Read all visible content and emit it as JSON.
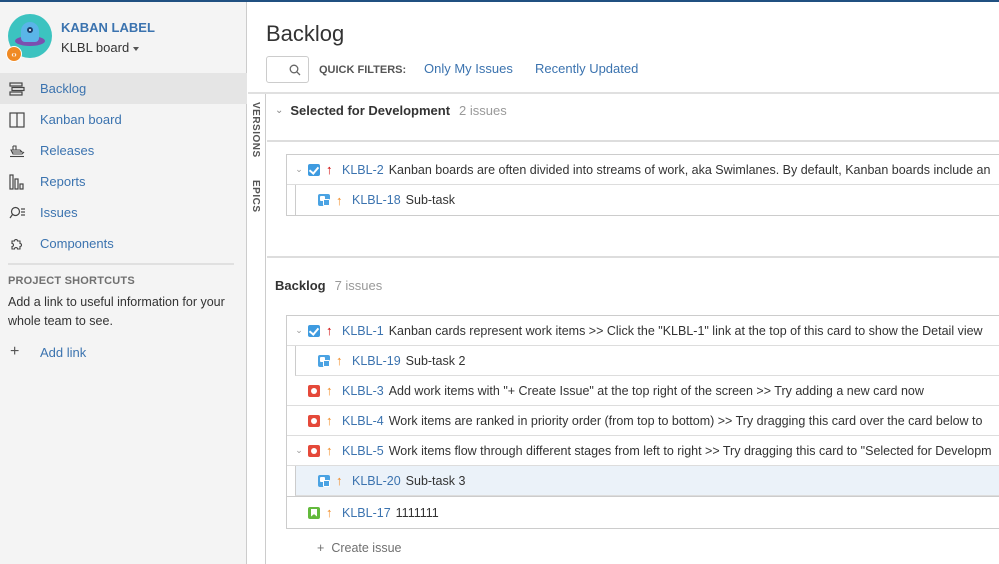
{
  "colors": {
    "link": "#3b73af",
    "header_bar": "#205081",
    "priority_high": "#ce0000",
    "priority_medium": "#f18a24",
    "story": "#3e9be0",
    "bug": "#e5493a",
    "improvement": "#63ba3c",
    "selected_row": "#ebf2f9"
  },
  "sidebar": {
    "project_name": "KABAN LABEL",
    "board_name": "KLBL board",
    "dev_badge": "‹›",
    "nav_items": [
      {
        "label": "Backlog",
        "icon": "backlog-icon",
        "active": true
      },
      {
        "label": "Kanban board",
        "icon": "board-icon",
        "active": false
      },
      {
        "label": "Releases",
        "icon": "ship-icon",
        "active": false
      },
      {
        "label": "Reports",
        "icon": "reports-icon",
        "active": false
      },
      {
        "label": "Issues",
        "icon": "issues-search-icon",
        "active": false
      },
      {
        "label": "Components",
        "icon": "puzzle-icon",
        "active": false
      }
    ],
    "shortcuts": {
      "title": "PROJECT SHORTCUTS",
      "text": "Add a link to useful information for your whole team to see.",
      "add_link": "Add link"
    }
  },
  "main": {
    "title": "Backlog",
    "search": {
      "placeholder": "",
      "value": ""
    },
    "quick_filters_label": "QUICK FILTERS:",
    "quick_filters": [
      "Only My Issues",
      "Recently Updated"
    ],
    "side_tabs": [
      "VERSIONS",
      "EPICS"
    ],
    "sections": [
      {
        "name": "Selected for Development",
        "count": "2 issues",
        "issues": [
          {
            "key": "KLBL-2",
            "type": "story",
            "priority": "high",
            "expandable": true,
            "sub": false,
            "summary": "Kanban boards are often divided into streams of work, aka Swimlanes. By default, Kanban boards include an"
          },
          {
            "key": "KLBL-18",
            "type": "sub-task",
            "priority": "medium",
            "expandable": false,
            "sub": true,
            "summary": "Sub-task"
          }
        ]
      },
      {
        "name": "Backlog",
        "count": "7 issues",
        "issues": [
          {
            "key": "KLBL-1",
            "type": "story",
            "priority": "high",
            "expandable": true,
            "sub": false,
            "summary": "Kanban cards represent work items >> Click the \"KLBL-1\" link at the top of this card to show the Detail view"
          },
          {
            "key": "KLBL-19",
            "type": "sub-task",
            "priority": "medium",
            "expandable": false,
            "sub": true,
            "summary": "Sub-task 2"
          },
          {
            "key": "KLBL-3",
            "type": "bug",
            "priority": "medium",
            "expandable": false,
            "sub": false,
            "summary": "Add work items with \"+ Create Issue\" at the top right of the screen >> Try adding a new card now"
          },
          {
            "key": "KLBL-4",
            "type": "bug",
            "priority": "medium",
            "expandable": false,
            "sub": false,
            "summary": "Work items are ranked in priority order (from top to bottom) >> Try dragging this card over the card below to"
          },
          {
            "key": "KLBL-5",
            "type": "bug",
            "priority": "medium",
            "expandable": true,
            "sub": false,
            "summary": "Work items flow through different stages from left to right >> Try dragging this card to \"Selected for Developm"
          },
          {
            "key": "KLBL-20",
            "type": "sub-task",
            "priority": "medium",
            "expandable": false,
            "sub": true,
            "selected": true,
            "summary": "Sub-task 3"
          },
          {
            "key": "KLBL-17",
            "type": "improvement",
            "priority": "medium",
            "expandable": false,
            "sub": false,
            "summary": "1111111"
          }
        ],
        "create_issue": "Create issue"
      }
    ]
  }
}
